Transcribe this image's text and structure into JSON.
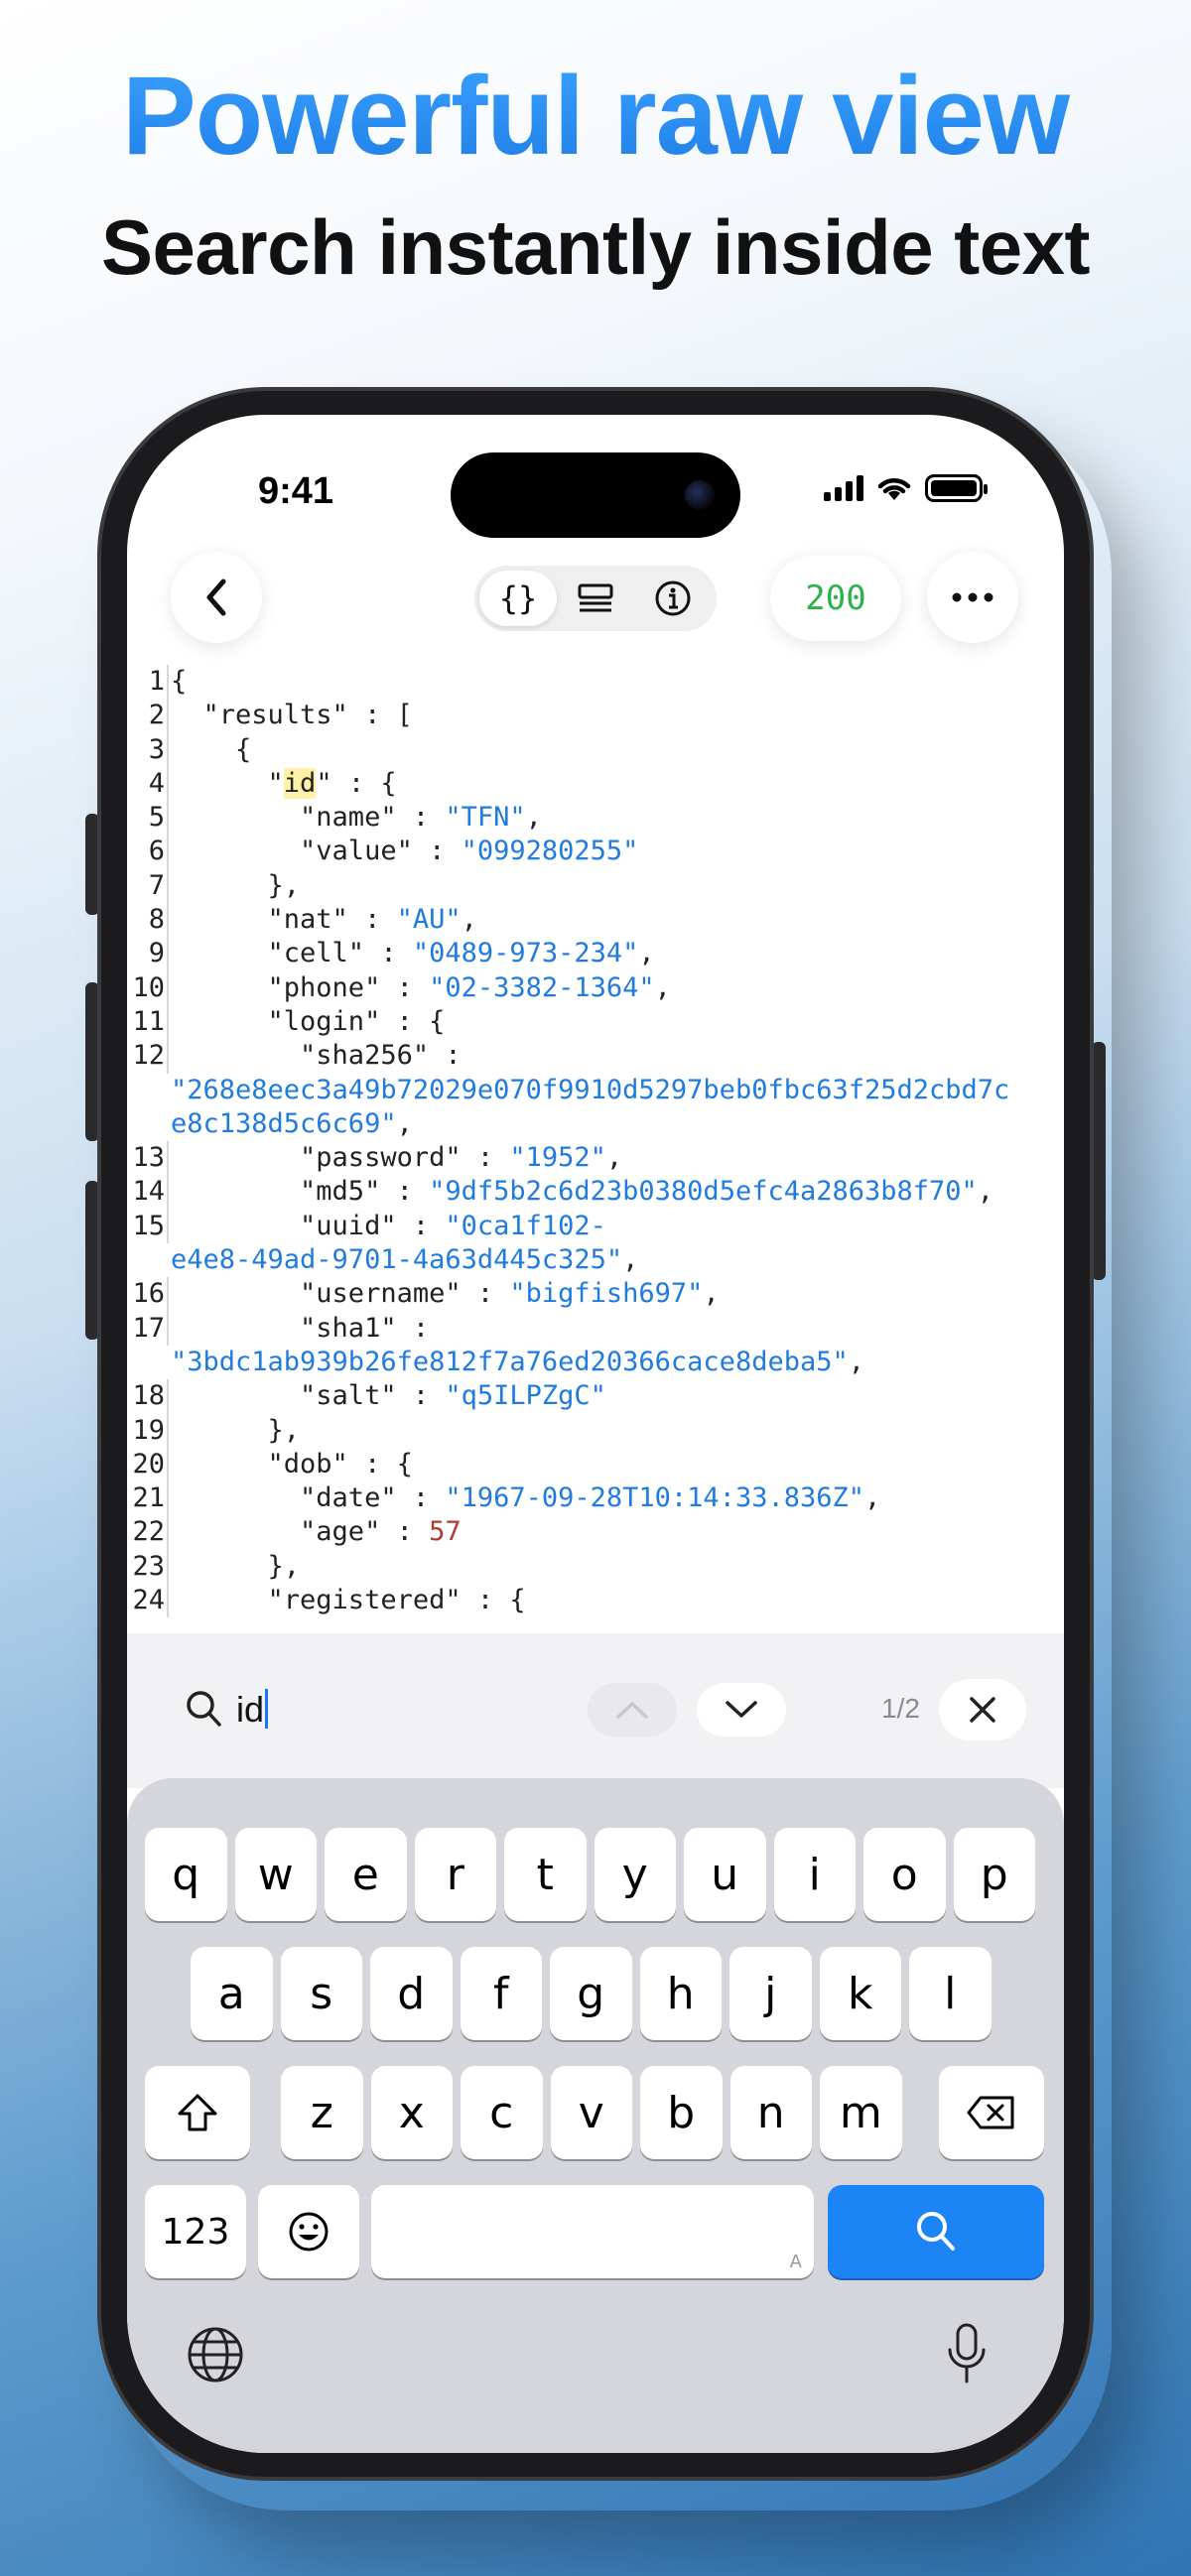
{
  "headline": "Powerful raw view",
  "subheadline": "Search instantly inside text",
  "status_bar": {
    "time": "9:41"
  },
  "toolbar": {
    "back_icon": "chevron-left-icon",
    "segments": [
      {
        "icon": "braces-icon",
        "active": true
      },
      {
        "icon": "list-view-icon",
        "active": false
      },
      {
        "icon": "info-icon",
        "active": false
      }
    ],
    "status_code": "200",
    "more_icon": "more-icon"
  },
  "code_lines": [
    {
      "n": "1",
      "parts": [
        [
          "p",
          "{"
        ]
      ]
    },
    {
      "n": "2",
      "parts": [
        [
          "p",
          "  \"results\" : ["
        ]
      ]
    },
    {
      "n": "3",
      "parts": [
        [
          "p",
          "    {"
        ]
      ]
    },
    {
      "n": "4",
      "parts": [
        [
          "p",
          "      \""
        ],
        [
          "h",
          "id"
        ],
        [
          "p",
          "\" : {"
        ]
      ]
    },
    {
      "n": "5",
      "parts": [
        [
          "p",
          "        \"name\" : "
        ],
        [
          "s",
          "\"TFN\""
        ],
        [
          "p",
          ","
        ]
      ]
    },
    {
      "n": "6",
      "parts": [
        [
          "p",
          "        \"value\" : "
        ],
        [
          "s",
          "\"099280255\""
        ]
      ]
    },
    {
      "n": "7",
      "parts": [
        [
          "p",
          "      },"
        ]
      ]
    },
    {
      "n": "8",
      "parts": [
        [
          "p",
          "      \"nat\" : "
        ],
        [
          "s",
          "\"AU\""
        ],
        [
          "p",
          ","
        ]
      ]
    },
    {
      "n": "9",
      "parts": [
        [
          "p",
          "      \"cell\" : "
        ],
        [
          "s",
          "\"0489-973-234\""
        ],
        [
          "p",
          ","
        ]
      ]
    },
    {
      "n": "10",
      "parts": [
        [
          "p",
          "      \"phone\" : "
        ],
        [
          "s",
          "\"02-3382-1364\""
        ],
        [
          "p",
          ","
        ]
      ]
    },
    {
      "n": "11",
      "parts": [
        [
          "p",
          "      \"login\" : {"
        ]
      ]
    },
    {
      "n": "12",
      "parts": [
        [
          "p",
          "        \"sha256\" :"
        ]
      ]
    },
    {
      "n": "",
      "parts": [
        [
          "s",
          "\"268e8eec3a49b72029e070f9910d5297beb0fbc63f25d2cbd7c"
        ]
      ]
    },
    {
      "n": "",
      "parts": [
        [
          "s",
          "e8c138d5c6c69\""
        ],
        [
          "p",
          ","
        ]
      ]
    },
    {
      "n": "13",
      "parts": [
        [
          "p",
          "        \"password\" : "
        ],
        [
          "s",
          "\"1952\""
        ],
        [
          "p",
          ","
        ]
      ]
    },
    {
      "n": "14",
      "parts": [
        [
          "p",
          "        \"md5\" : "
        ],
        [
          "s",
          "\"9df5b2c6d23b0380d5efc4a2863b8f70\""
        ],
        [
          "p",
          ","
        ]
      ]
    },
    {
      "n": "15",
      "parts": [
        [
          "p",
          "        \"uuid\" : "
        ],
        [
          "s",
          "\"0ca1f102-"
        ]
      ]
    },
    {
      "n": "",
      "parts": [
        [
          "s",
          "e4e8-49ad-9701-4a63d445c325\""
        ],
        [
          "p",
          ","
        ]
      ]
    },
    {
      "n": "16",
      "parts": [
        [
          "p",
          "        \"username\" : "
        ],
        [
          "s",
          "\"bigfish697\""
        ],
        [
          "p",
          ","
        ]
      ]
    },
    {
      "n": "17",
      "parts": [
        [
          "p",
          "        \"sha1\" :"
        ]
      ]
    },
    {
      "n": "",
      "parts": [
        [
          "s",
          "\"3bdc1ab939b26fe812f7a76ed20366cace8deba5\""
        ],
        [
          "p",
          ","
        ]
      ]
    },
    {
      "n": "18",
      "parts": [
        [
          "p",
          "        \"salt\" : "
        ],
        [
          "s",
          "\"q5ILPZgC\""
        ]
      ]
    },
    {
      "n": "19",
      "parts": [
        [
          "p",
          "      },"
        ]
      ]
    },
    {
      "n": "20",
      "parts": [
        [
          "p",
          "      \"dob\" : {"
        ]
      ]
    },
    {
      "n": "21",
      "parts": [
        [
          "p",
          "        \"date\" : "
        ],
        [
          "s",
          "\"1967-09-28T10:14:33.836Z\""
        ],
        [
          "p",
          ","
        ]
      ]
    },
    {
      "n": "22",
      "parts": [
        [
          "p",
          "        \"age\" : "
        ],
        [
          "n",
          "57"
        ]
      ]
    },
    {
      "n": "23",
      "parts": [
        [
          "p",
          "      },"
        ]
      ]
    },
    {
      "n": "24",
      "parts": [
        [
          "p",
          "      \"registered\" : {"
        ]
      ]
    }
  ],
  "search": {
    "query": "id",
    "match_count": "1/2",
    "icons": {
      "search": "search-icon",
      "prev": "chevron-up-icon",
      "next": "chevron-down-icon",
      "close": "close-icon"
    }
  },
  "keyboard": {
    "row1": [
      "q",
      "w",
      "e",
      "r",
      "t",
      "y",
      "u",
      "i",
      "o",
      "p"
    ],
    "row2": [
      "a",
      "s",
      "d",
      "f",
      "g",
      "h",
      "j",
      "k",
      "l"
    ],
    "row3": [
      "z",
      "x",
      "c",
      "v",
      "b",
      "n",
      "m"
    ],
    "numbers_label": "123",
    "space_mark": "A",
    "icons": {
      "shift": "shift-icon",
      "delete": "delete-icon",
      "emoji": "emoji-icon",
      "search": "search-icon",
      "globe": "globe-icon",
      "mic": "microphone-icon"
    }
  },
  "colors": {
    "accent": "#1d84f6",
    "string": "#1f7be0",
    "number": "#b03a2e",
    "status_ok": "#2bb24c",
    "highlight": "#fff2a6"
  }
}
